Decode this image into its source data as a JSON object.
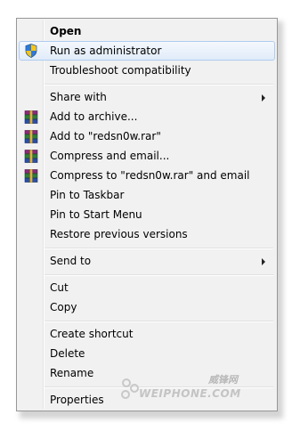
{
  "menu": {
    "items": [
      {
        "label": "Open",
        "bold": true
      },
      {
        "label": "Run as administrator",
        "icon": "uac-shield-icon"
      },
      {
        "label": "Troubleshoot compatibility"
      },
      {
        "label": "Share with",
        "submenu": true
      },
      {
        "label": "Add to archive...",
        "icon": "winrar-icon"
      },
      {
        "label": "Add to \"redsn0w.rar\"",
        "icon": "winrar-icon"
      },
      {
        "label": "Compress and email...",
        "icon": "winrar-icon"
      },
      {
        "label": "Compress to \"redsn0w.rar\" and email",
        "icon": "winrar-icon"
      },
      {
        "label": "Pin to Taskbar"
      },
      {
        "label": "Pin to Start Menu"
      },
      {
        "label": "Restore previous versions"
      },
      {
        "label": "Send to",
        "submenu": true
      },
      {
        "label": "Cut"
      },
      {
        "label": "Copy"
      },
      {
        "label": "Create shortcut"
      },
      {
        "label": "Delete"
      },
      {
        "label": "Rename"
      },
      {
        "label": "Properties"
      }
    ]
  },
  "watermark": {
    "top_text": "威锋网",
    "main_text": "WEIPHONE.COM"
  },
  "colors": {
    "menu_background": "#f1f1f1",
    "hover_border": "#aeccf1",
    "hover_fill": "#e1ecf9"
  }
}
